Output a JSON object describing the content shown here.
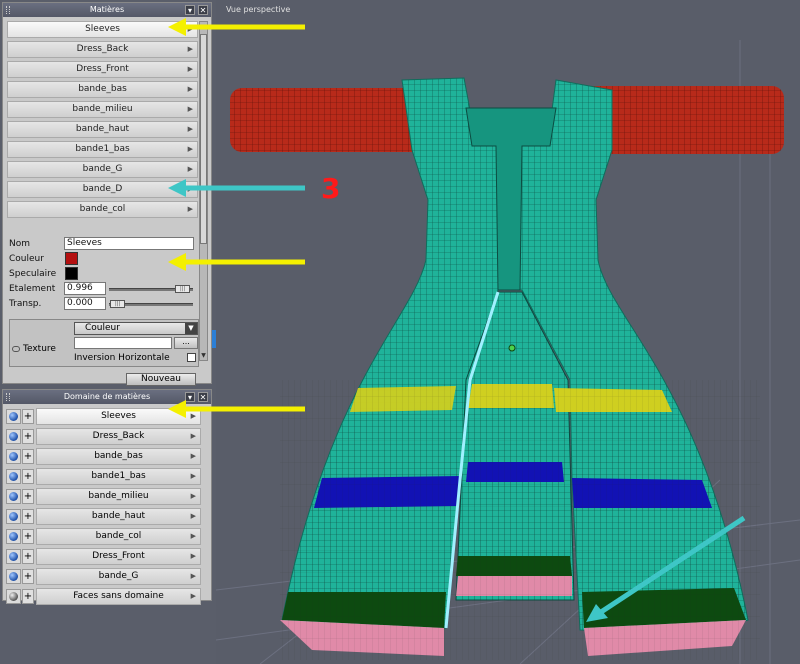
{
  "materials_panel": {
    "title": "Matières",
    "items": [
      {
        "label": "Sleeves"
      },
      {
        "label": "Dress_Back"
      },
      {
        "label": "Dress_Front"
      },
      {
        "label": "bande_bas"
      },
      {
        "label": "bande_milieu"
      },
      {
        "label": "bande_haut"
      },
      {
        "label": "bande1_bas"
      },
      {
        "label": "bande_G"
      },
      {
        "label": "bande_D"
      },
      {
        "label": "bande_col"
      }
    ],
    "props": {
      "nom_label": "Nom",
      "nom_value": "Sleeves",
      "couleur_label": "Couleur",
      "couleur_color": "#b41010",
      "speculaire_label": "Speculaire",
      "speculaire_color": "#000000",
      "etalement_label": "Etalement",
      "etalement_value": "0.996",
      "transp_label": "Transp.",
      "transp_value": "0.000"
    },
    "texture": {
      "label": "Texture",
      "select_value": "Couleur",
      "browse": "...",
      "inversion_label": "Inversion Horizontale"
    },
    "new_button": "Nouveau"
  },
  "domain_panel": {
    "title": "Domaine de matières",
    "items": [
      {
        "label": "Sleeves"
      },
      {
        "label": "Dress_Back"
      },
      {
        "label": "bande_bas"
      },
      {
        "label": "bande1_bas"
      },
      {
        "label": "bande_milieu"
      },
      {
        "label": "bande_haut"
      },
      {
        "label": "bande_col"
      },
      {
        "label": "Dress_Front"
      },
      {
        "label": "bande_G"
      },
      {
        "label": "Faces sans domaine"
      }
    ]
  },
  "viewport": {
    "title": "Vue perspective",
    "annotation_number": "3",
    "colors": {
      "sleeve": "#b82a1a",
      "body": "#1fb39a",
      "yellow_band": "#cfcf20",
      "blue_band": "#1212b4",
      "green_band": "#0d4a10",
      "pink_band": "#e08aa8",
      "yellow_arrow": "#f4f000",
      "cyan_arrow": "#3ec6c6",
      "number": "#ff1a1a"
    }
  }
}
